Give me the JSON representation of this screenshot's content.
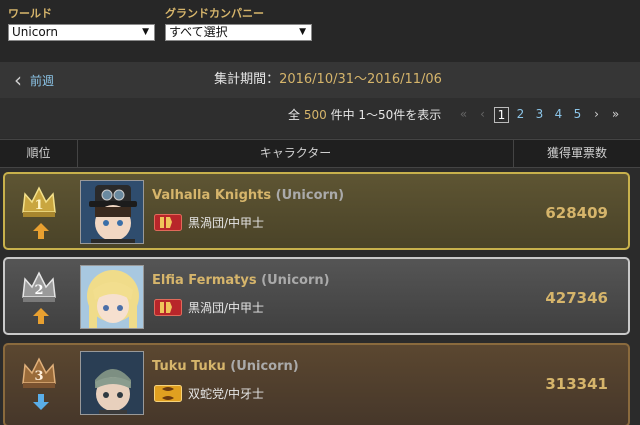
{
  "filters": {
    "world": {
      "label": "ワールド",
      "value": "Unicorn"
    },
    "grand_company": {
      "label": "グランドカンパニー",
      "value": "すべて選択"
    }
  },
  "period": {
    "prev_label": "前週",
    "label": "集計期間：",
    "value": "2016/10/31～2016/11/06"
  },
  "count": {
    "prefix": "全",
    "total": "500",
    "suffix": "件中 1～50件を表示"
  },
  "pagination": {
    "first": "«",
    "prev": "‹",
    "pages": [
      "1",
      "2",
      "3",
      "4",
      "5"
    ],
    "current": "1",
    "next": "›",
    "last": "»"
  },
  "table": {
    "headers": {
      "rank": "順位",
      "character": "キャラクター",
      "votes": "獲得軍票数"
    }
  },
  "rows": [
    {
      "rank": "1",
      "trend": "up",
      "name": "Valhalla Knights",
      "world": "(Unicorn)",
      "gc": "黒渦団/中甲士",
      "gc_color": "red",
      "score": "628409",
      "tier": "gold"
    },
    {
      "rank": "2",
      "trend": "up",
      "name": "Elfia Fermatys",
      "world": "(Unicorn)",
      "gc": "黒渦団/中甲士",
      "gc_color": "red",
      "score": "427346",
      "tier": "silver"
    },
    {
      "rank": "3",
      "trend": "down",
      "name": "Tuku Tuku",
      "world": "(Unicorn)",
      "gc": "双蛇党/中牙士",
      "gc_color": "yellow",
      "score": "313341",
      "tier": "bronze"
    }
  ],
  "colors": {
    "accent_gold": "#d6b56b",
    "link_blue": "#8cc5e8",
    "trend_up": "#e8a030",
    "trend_down": "#5aaee8"
  }
}
